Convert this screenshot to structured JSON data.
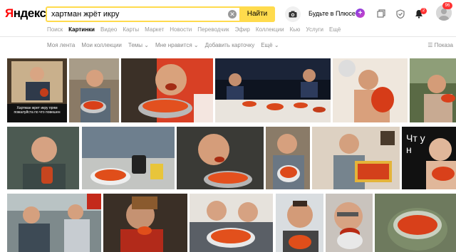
{
  "logo": {
    "text_red": "Я",
    "text_rest": "ндекс"
  },
  "search": {
    "query": "хартман жрёт икру",
    "find_label": "Найти"
  },
  "header": {
    "plus_text": "Будьте в Плюсе",
    "notif_count": "2",
    "avatar_count": "96"
  },
  "tabs": [
    {
      "label": "Поиск"
    },
    {
      "label": "Картинки",
      "active": true
    },
    {
      "label": "Видео"
    },
    {
      "label": "Карты"
    },
    {
      "label": "Маркет"
    },
    {
      "label": "Новости"
    },
    {
      "label": "Переводчик"
    },
    {
      "label": "Эфир"
    },
    {
      "label": "Коллекции"
    },
    {
      "label": "Кью"
    },
    {
      "label": "Услуги"
    },
    {
      "label": "Ещё"
    }
  ],
  "subbar": {
    "my_feed": "Моя лента",
    "my_collections": "Мои коллекции",
    "topics": "Темы",
    "i_like": "Мне нравится",
    "add_card": "Добавить карточку",
    "more": "Ещё",
    "filters": "Показа"
  },
  "images": [
    {
      "caption": "Хартман жрет икру прям пожалуйста по что повешен"
    },
    {
      "caption": ""
    },
    {
      "caption": ""
    },
    {
      "caption": ""
    },
    {
      "caption": ""
    },
    {
      "caption": ""
    },
    {
      "caption": ""
    },
    {
      "caption": ""
    },
    {
      "caption": ""
    },
    {
      "caption": ""
    },
    {
      "caption": ""
    },
    {
      "caption": "Чт у н",
      "overlay": true
    },
    {
      "caption": ""
    },
    {
      "caption": ""
    },
    {
      "caption": ""
    },
    {
      "caption": ""
    },
    {
      "caption": ""
    },
    {
      "caption": ""
    }
  ]
}
